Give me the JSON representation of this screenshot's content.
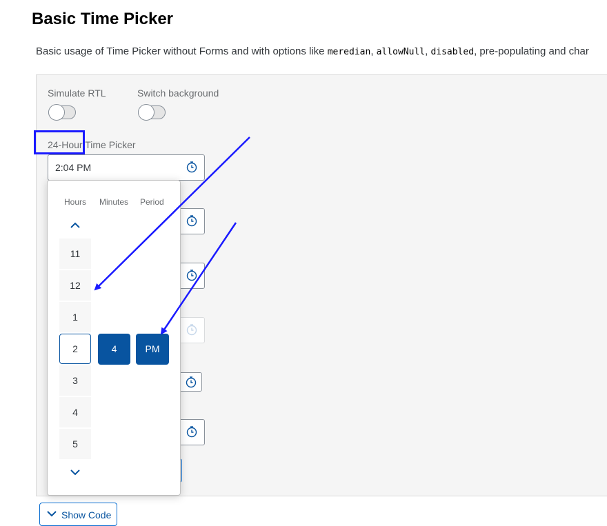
{
  "page": {
    "title": "Basic Time Picker",
    "description_prefix": "Basic usage of Time Picker without Forms and with options like ",
    "code_terms": [
      "meredian",
      "allowNull",
      "disabled"
    ],
    "description_suffix": ", pre-populating and char"
  },
  "controls": {
    "simulate_rtl": {
      "label": "Simulate RTL",
      "checked": false
    },
    "switch_background": {
      "label": "Switch background",
      "checked": false
    }
  },
  "time_picker": {
    "label": "24-Hour Time Picker",
    "value": "2:04 PM",
    "icon": "clock-icon"
  },
  "popover": {
    "columns": [
      "Hours",
      "Minutes",
      "Period"
    ],
    "hours": [
      "11",
      "12",
      "1",
      "2",
      "3",
      "4",
      "5"
    ],
    "selected_hour": "2",
    "selected_minute": "4",
    "selected_period": "PM",
    "up_icon": "chevron-up-icon",
    "down_icon": "chevron-down-icon"
  },
  "show_code": {
    "label": "Show Code",
    "icon": "chevron-down-icon"
  },
  "colors": {
    "accent": "#0854a0",
    "annotation": "#1a1aff",
    "panel_bg": "#f5f5f5"
  }
}
